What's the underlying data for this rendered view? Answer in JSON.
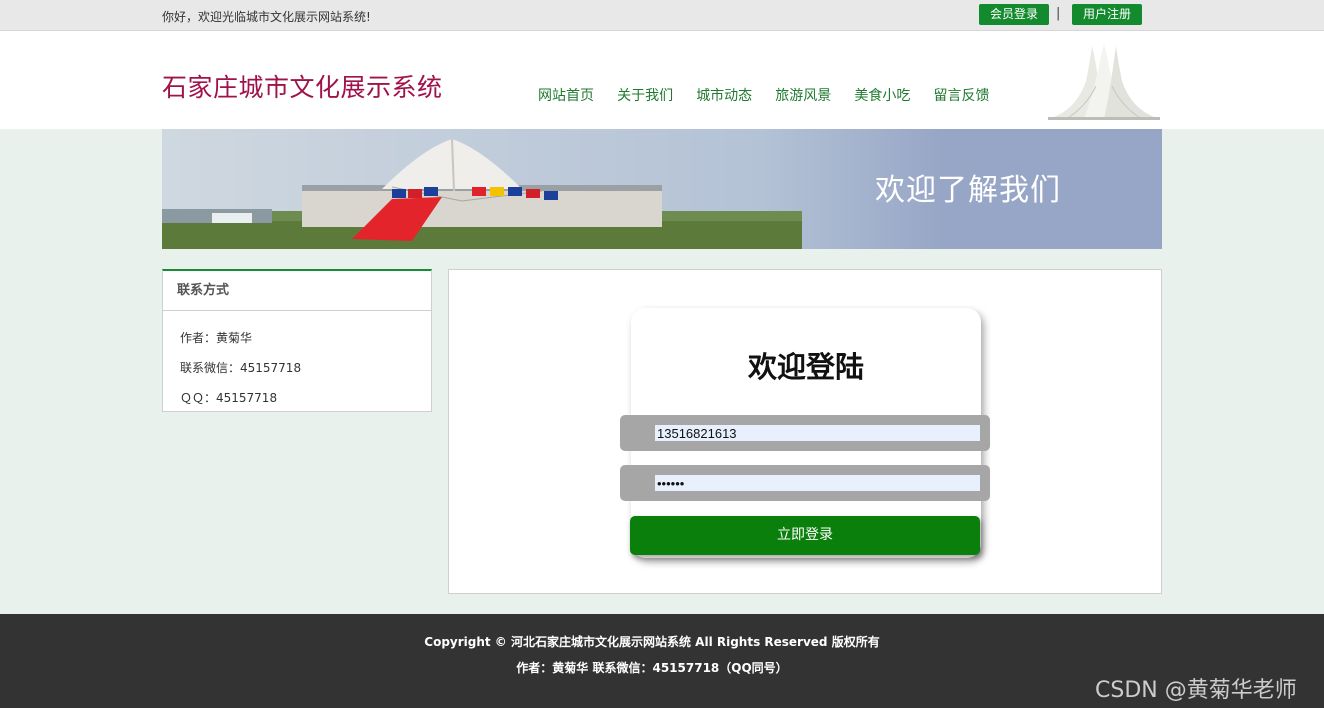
{
  "topbar": {
    "welcome": "你好，欢迎光临城市文化展示网站系统!",
    "login_label": "会员登录",
    "separator": "|",
    "register_label": "用户注册"
  },
  "header": {
    "site_title": "石家庄城市文化展示系统",
    "nav": [
      "网站首页",
      "关于我们",
      "城市动态",
      "旅游风景",
      "美食小吃",
      "留言反馈"
    ]
  },
  "banner": {
    "tagline": "欢迎了解我们"
  },
  "sidebar": {
    "title": "联系方式",
    "lines": [
      "作者：黄菊华",
      "联系微信：45157718",
      "ＱＱ：45157718"
    ]
  },
  "login": {
    "heading": "欢迎登陆",
    "username_value": "13516821613",
    "password_value": "••••••",
    "submit_label": "立即登录"
  },
  "footer": {
    "line1": "Copyright © 河北石家庄城市文化展示网站系统 All Rights Reserved 版权所有",
    "line2": "作者：黄菊华 联系微信：45157718（QQ同号）"
  },
  "watermark": "CSDN @黄菊华老师",
  "colors": {
    "accent_green": "#128a2d",
    "title_red": "#a0124a",
    "footer_bg": "#333333",
    "button_green": "#0b7f0b"
  }
}
